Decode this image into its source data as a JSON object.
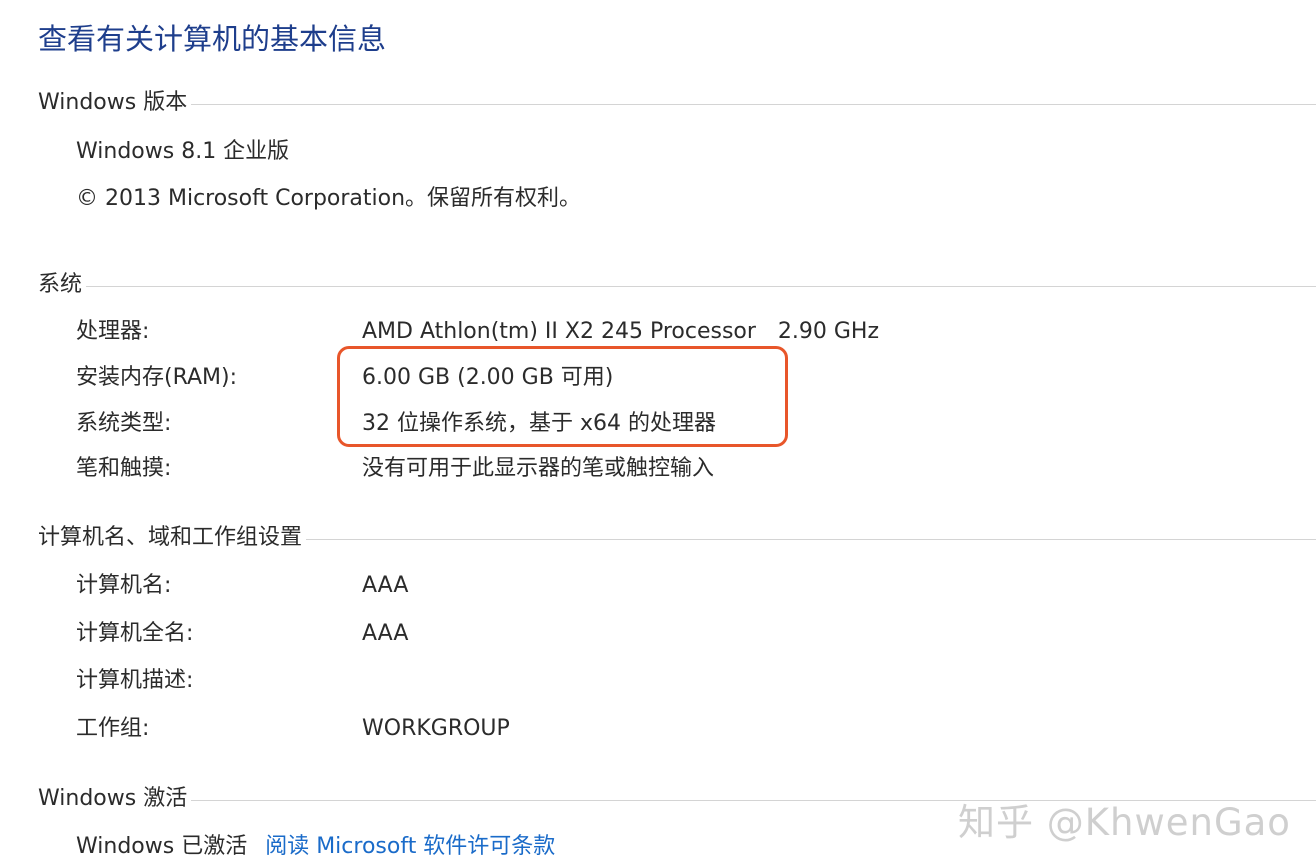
{
  "page": {
    "title": "查看有关计算机的基本信息"
  },
  "windows_edition": {
    "header": "Windows 版本",
    "edition": "Windows 8.1 企业版",
    "copyright": "© 2013 Microsoft Corporation。保留所有权利。"
  },
  "system": {
    "header": "系统",
    "rows": [
      {
        "label": "处理器:",
        "value": "AMD Athlon(tm) II X2 245 Processor",
        "value2": "2.90 GHz"
      },
      {
        "label": "安装内存(RAM):",
        "value": "6.00 GB (2.00 GB 可用)"
      },
      {
        "label": "系统类型:",
        "value": "32 位操作系统，基于 x64 的处理器"
      },
      {
        "label": "笔和触摸:",
        "value": "没有可用于此显示器的笔或触控输入"
      }
    ]
  },
  "computer_name": {
    "header": "计算机名、域和工作组设置",
    "rows": [
      {
        "label": "计算机名:",
        "value": "AAA"
      },
      {
        "label": "计算机全名:",
        "value": "AAA"
      },
      {
        "label": "计算机描述:",
        "value": ""
      },
      {
        "label": "工作组:",
        "value": "WORKGROUP"
      }
    ]
  },
  "activation": {
    "header": "Windows 激活",
    "status": "Windows 已激活",
    "link": "阅读 Microsoft 软件许可条款"
  },
  "watermark": "知乎 @KhwenGao",
  "colors": {
    "title": "#1e3e8c",
    "link": "#1a6bc9",
    "highlight": "#e8562a"
  }
}
